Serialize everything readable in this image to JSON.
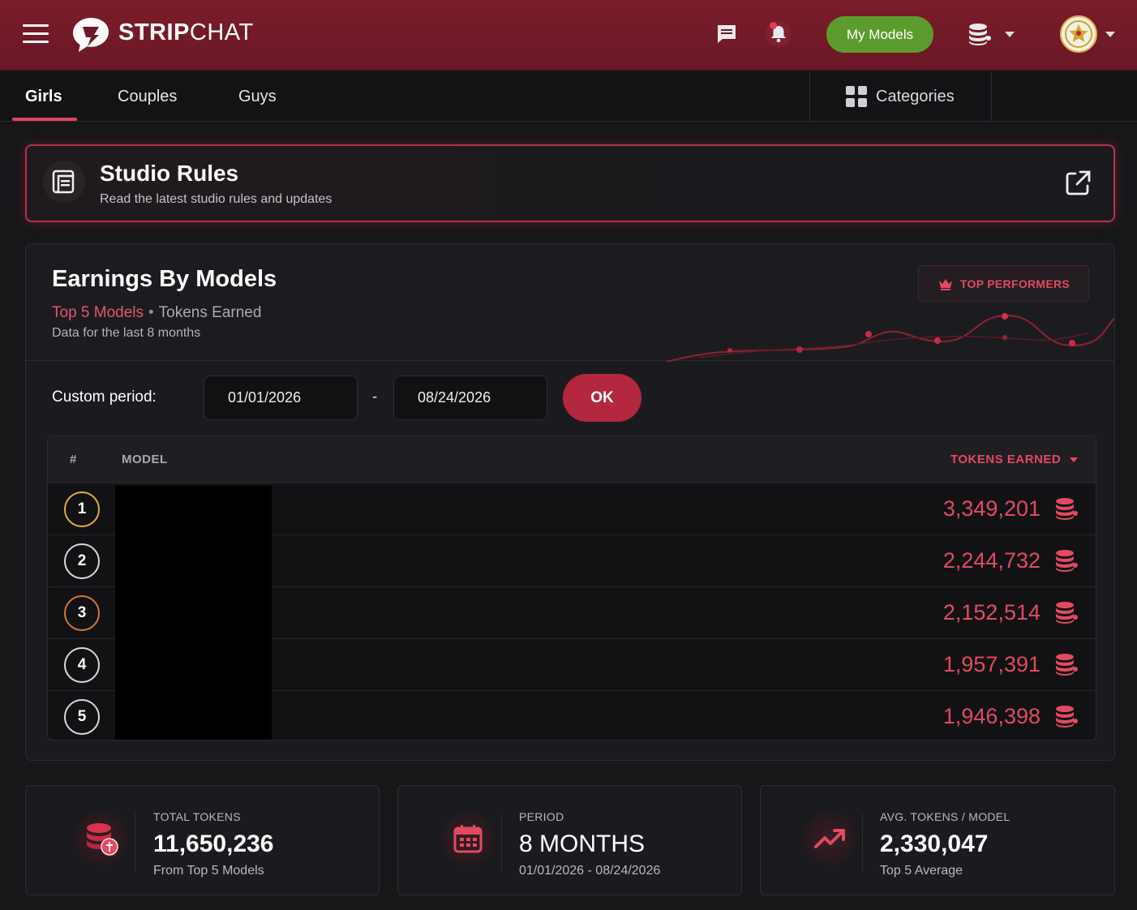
{
  "header": {
    "brand_bold": "STRIP",
    "brand_rest": "CHAT",
    "my_models_label": "My Models"
  },
  "tabs": [
    {
      "label": "Girls",
      "active": true
    },
    {
      "label": "Couples",
      "active": false
    },
    {
      "label": "Guys",
      "active": false
    }
  ],
  "categories_label": "Categories",
  "studio_rules": {
    "title": "Studio Rules",
    "subtitle": "Read the latest studio rules and updates"
  },
  "earnings": {
    "title": "Earnings By Models",
    "subtitle_highlight": "Top 5 Models",
    "subtitle_rest": "Tokens Earned",
    "note": "Data for the last 8 months",
    "top_performers_label": "TOP PERFORMERS",
    "custom_period_label": "Custom period:",
    "date_from": "01/01/2026",
    "date_separator": "-",
    "date_to": "08/24/2026",
    "ok_label": "OK",
    "columns": {
      "rank": "#",
      "model": "MODEL",
      "tokens": "TOKENS EARNED"
    },
    "rows": [
      {
        "rank": "1",
        "tokens": "3,349,201"
      },
      {
        "rank": "2",
        "tokens": "2,244,732"
      },
      {
        "rank": "3",
        "tokens": "2,152,514"
      },
      {
        "rank": "4",
        "tokens": "1,957,391"
      },
      {
        "rank": "5",
        "tokens": "1,946,398"
      }
    ]
  },
  "stats": {
    "total": {
      "label": "TOTAL TOKENS",
      "value": "11,650,236",
      "sub": "From Top 5 Models"
    },
    "period": {
      "label": "PERIOD",
      "value": "8 MONTHS",
      "sub": "01/01/2026 - 08/24/2026"
    },
    "average": {
      "label": "AVG. TOKENS / MODEL",
      "value": "2,330,047",
      "sub": "Top 5 Average"
    }
  },
  "colors": {
    "header_bg": "#7a1c2b",
    "accent": "#e24a60",
    "my_models_bg": "#5c9b2e",
    "ok_bg": "#b3283f"
  }
}
